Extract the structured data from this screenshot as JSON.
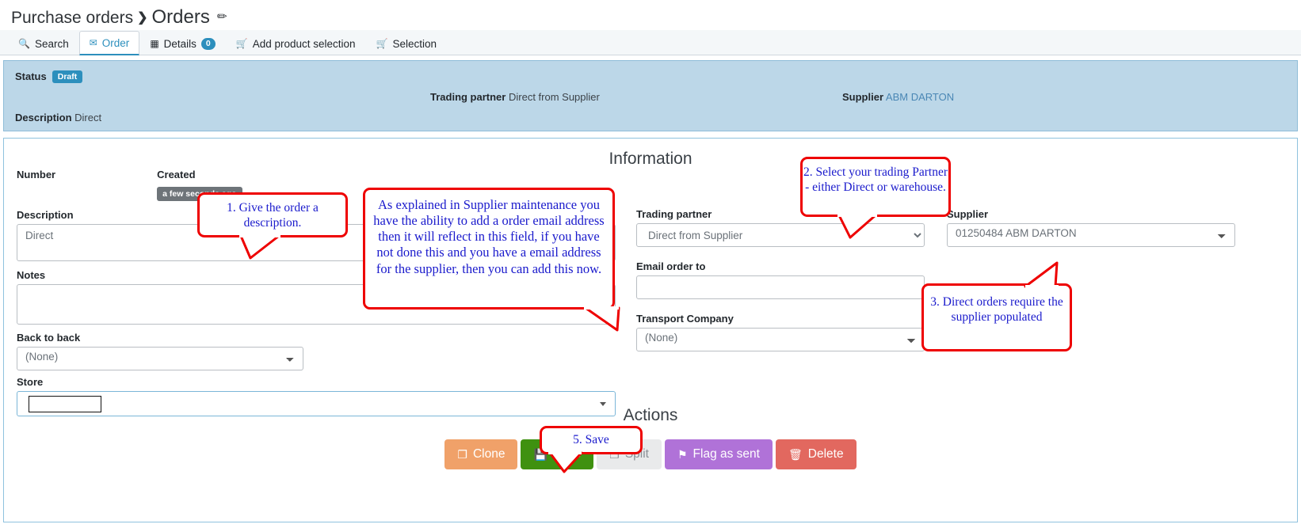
{
  "breadcrumb": {
    "parent": "Purchase orders",
    "separator": "❯",
    "current": "Orders",
    "pin_icon": "✐"
  },
  "tabs": [
    {
      "label": "Search",
      "icon": "🔍",
      "icon_name": "search-icon",
      "active": false,
      "badge": ""
    },
    {
      "label": "Order",
      "icon": "✉",
      "icon_name": "envelope-icon",
      "active": true,
      "badge": ""
    },
    {
      "label": "Details",
      "icon": "▦",
      "icon_name": "grid-icon",
      "active": false,
      "badge": "0"
    },
    {
      "label": "Add product selection",
      "icon": "🛒",
      "icon_name": "basket-icon",
      "active": false,
      "badge": ""
    },
    {
      "label": "Selection",
      "icon": "🛒",
      "icon_name": "cart-icon",
      "active": false,
      "badge": ""
    }
  ],
  "status_band": {
    "status_label": "Status",
    "status_value": "Draft",
    "trading_partner_label": "Trading partner",
    "trading_partner_value": "Direct from Supplier",
    "supplier_label": "Supplier",
    "supplier_value": "ABM DARTON",
    "description_label": "Description",
    "description_value": "Direct"
  },
  "panel": {
    "information_title": "Information",
    "actions_title": "Actions"
  },
  "form": {
    "number_label": "Number",
    "number_value": "",
    "created_label": "Created",
    "created_value": "a few seconds ago",
    "description_label": "Description",
    "description_value": "Direct",
    "notes_label": "Notes",
    "notes_value": "",
    "back_to_back_label": "Back to back",
    "back_to_back_value": "(None)",
    "store_label": "Store",
    "store_value": "",
    "trading_partner_label": "Trading partner",
    "trading_partner_value": "Direct from Supplier",
    "email_order_to_label": "Email order to",
    "email_order_to_value": "",
    "transport_company_label": "Transport Company",
    "transport_company_value": "(None)",
    "supplier_label": "Supplier",
    "supplier_value": "01250484 ABM DARTON"
  },
  "buttons": [
    {
      "label": "Clone",
      "icon": "❐",
      "icon_name": "clone-icon",
      "color": "#f0a169"
    },
    {
      "label": "Save",
      "icon": "💾",
      "icon_name": "save-disk-icon",
      "color": "#3f9110"
    },
    {
      "label": "Split",
      "icon": "❐",
      "icon_name": "split-icon",
      "color": "#e9eaeb"
    },
    {
      "label": "Flag as sent",
      "icon": "⚑",
      "icon_name": "flag-icon",
      "color": "#b072d8"
    },
    {
      "label": "Delete",
      "icon": "🗑",
      "icon_name": "trash-icon",
      "color": "#e2685f"
    }
  ],
  "callouts": {
    "one": "1. Give the order a description.",
    "two": "2. Select your trading Partner - either Direct or warehouse.",
    "three": "3. Direct orders require the supplier populated",
    "four": "As explained in Supplier maintenance you have the ability to add a order email address then it will reflect in this field, if you have not done this and you have a email address for the supplier, then you can add this now.",
    "five": "5. Save"
  },
  "colors": {
    "accent": "#2c8fbd",
    "band_bg": "#bcd7e8",
    "callout_border": "#ee0000",
    "callout_text": "#1a1acc",
    "save_green": "#3f9110"
  }
}
